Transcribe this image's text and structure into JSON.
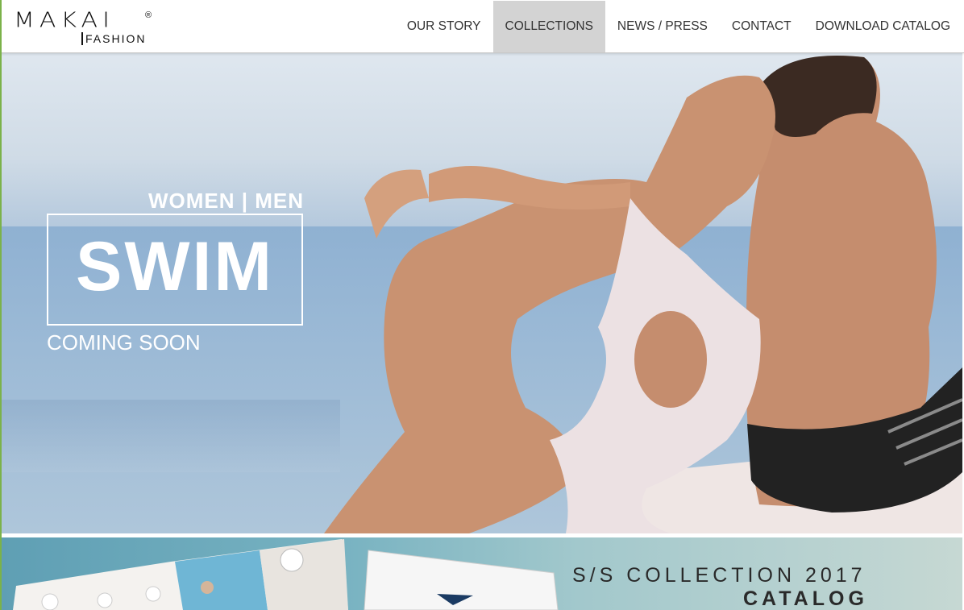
{
  "brand": {
    "name": "MAKAI",
    "registered": "®",
    "sub": "FASHION"
  },
  "nav": {
    "items": [
      {
        "label": "OUR STORY"
      },
      {
        "label": "COLLECTIONS",
        "active": true
      },
      {
        "label": "NEWS / PRESS"
      },
      {
        "label": "CONTACT"
      },
      {
        "label": "DOWNLOAD CATALOG"
      }
    ]
  },
  "hero": {
    "tagline": "WOMEN | MEN",
    "headline": "SWIM",
    "subline": "COMING SOON"
  },
  "catalog": {
    "line1": "S/S COLLECTION 2017",
    "line2": "CATALOG"
  },
  "colors": {
    "accent_active_nav": "#d3d3d3",
    "left_border": "#7bb24a"
  }
}
